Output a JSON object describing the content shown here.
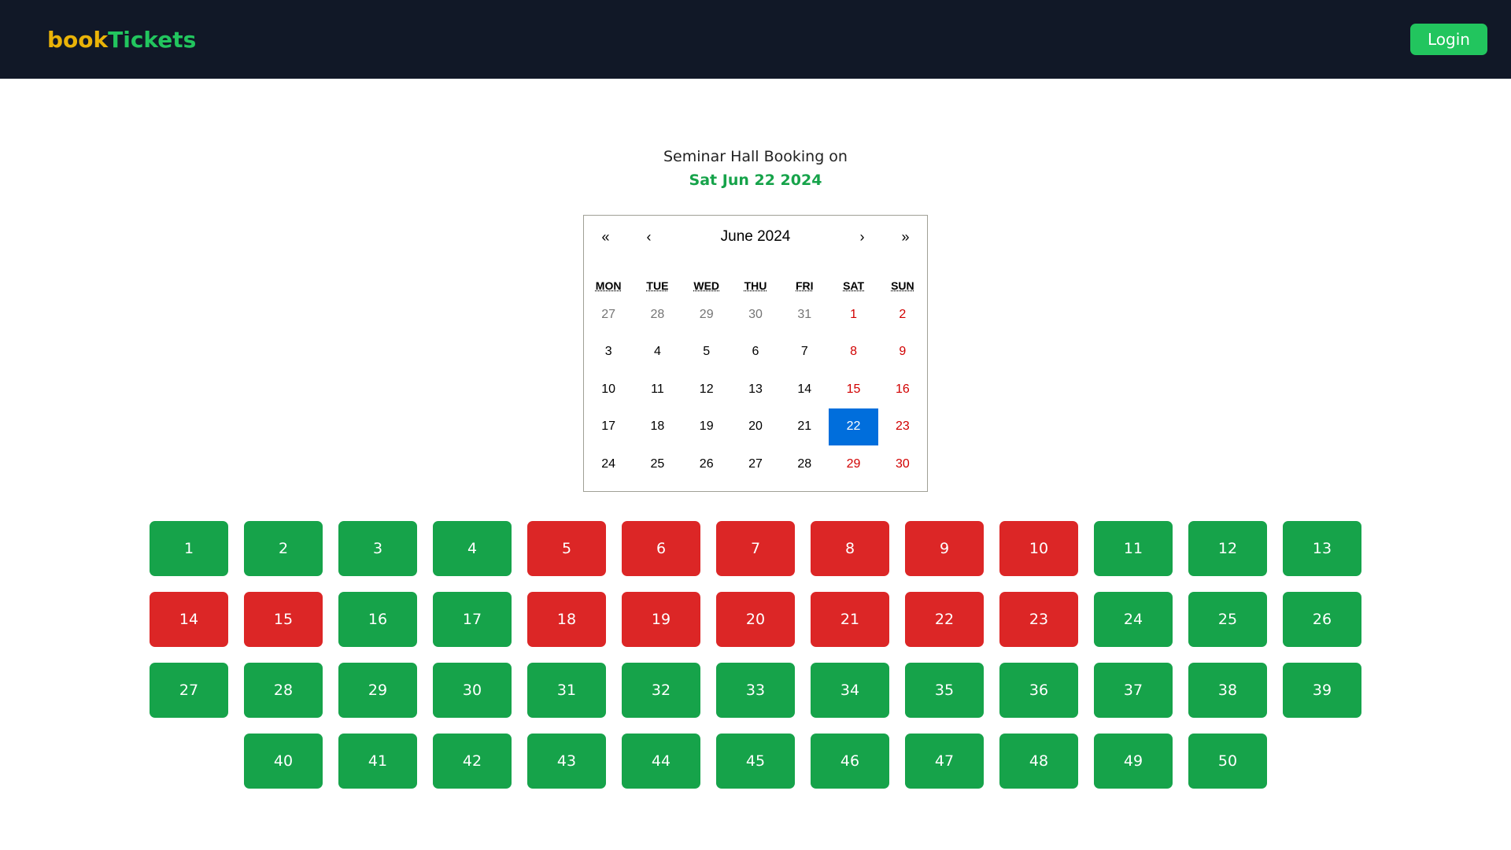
{
  "navbar": {
    "brand_part1": "book",
    "brand_part2": "Tickets",
    "login_label": "Login"
  },
  "heading": {
    "line1": "Seminar Hall Booking on",
    "date": "Sat Jun 22 2024"
  },
  "calendar": {
    "nav": {
      "prev2": "«",
      "prev": "‹",
      "label": "June 2024",
      "next": "›",
      "next2": "»"
    },
    "weekdays": [
      "MON",
      "TUE",
      "WED",
      "THU",
      "FRI",
      "SAT",
      "SUN"
    ],
    "days": [
      {
        "d": "27",
        "t": "neighbor"
      },
      {
        "d": "28",
        "t": "neighbor"
      },
      {
        "d": "29",
        "t": "neighbor"
      },
      {
        "d": "30",
        "t": "neighbor"
      },
      {
        "d": "31",
        "t": "neighbor"
      },
      {
        "d": "1",
        "t": "weekend"
      },
      {
        "d": "2",
        "t": "weekend"
      },
      {
        "d": "3",
        "t": ""
      },
      {
        "d": "4",
        "t": ""
      },
      {
        "d": "5",
        "t": ""
      },
      {
        "d": "6",
        "t": ""
      },
      {
        "d": "7",
        "t": ""
      },
      {
        "d": "8",
        "t": "weekend"
      },
      {
        "d": "9",
        "t": "weekend"
      },
      {
        "d": "10",
        "t": ""
      },
      {
        "d": "11",
        "t": ""
      },
      {
        "d": "12",
        "t": ""
      },
      {
        "d": "13",
        "t": ""
      },
      {
        "d": "14",
        "t": ""
      },
      {
        "d": "15",
        "t": "weekend"
      },
      {
        "d": "16",
        "t": "weekend"
      },
      {
        "d": "17",
        "t": ""
      },
      {
        "d": "18",
        "t": ""
      },
      {
        "d": "19",
        "t": ""
      },
      {
        "d": "20",
        "t": ""
      },
      {
        "d": "21",
        "t": ""
      },
      {
        "d": "22",
        "t": "selected"
      },
      {
        "d": "23",
        "t": "weekend"
      },
      {
        "d": "24",
        "t": ""
      },
      {
        "d": "25",
        "t": ""
      },
      {
        "d": "26",
        "t": ""
      },
      {
        "d": "27",
        "t": ""
      },
      {
        "d": "28",
        "t": ""
      },
      {
        "d": "29",
        "t": "weekend"
      },
      {
        "d": "30",
        "t": "weekend"
      }
    ]
  },
  "colors": {
    "available": "#16a34a",
    "booked": "#dc2626",
    "selected_day": "#006edc"
  },
  "seats": [
    [
      {
        "n": "1",
        "s": "available"
      },
      {
        "n": "2",
        "s": "available"
      },
      {
        "n": "3",
        "s": "available"
      },
      {
        "n": "4",
        "s": "available"
      },
      {
        "n": "5",
        "s": "booked"
      },
      {
        "n": "6",
        "s": "booked"
      },
      {
        "n": "7",
        "s": "booked"
      },
      {
        "n": "8",
        "s": "booked"
      },
      {
        "n": "9",
        "s": "booked"
      },
      {
        "n": "10",
        "s": "booked"
      },
      {
        "n": "11",
        "s": "available"
      },
      {
        "n": "12",
        "s": "available"
      },
      {
        "n": "13",
        "s": "available"
      }
    ],
    [
      {
        "n": "14",
        "s": "booked"
      },
      {
        "n": "15",
        "s": "booked"
      },
      {
        "n": "16",
        "s": "available"
      },
      {
        "n": "17",
        "s": "available"
      },
      {
        "n": "18",
        "s": "booked"
      },
      {
        "n": "19",
        "s": "booked"
      },
      {
        "n": "20",
        "s": "booked"
      },
      {
        "n": "21",
        "s": "booked"
      },
      {
        "n": "22",
        "s": "booked"
      },
      {
        "n": "23",
        "s": "booked"
      },
      {
        "n": "24",
        "s": "available"
      },
      {
        "n": "25",
        "s": "available"
      },
      {
        "n": "26",
        "s": "available"
      }
    ],
    [
      {
        "n": "27",
        "s": "available"
      },
      {
        "n": "28",
        "s": "available"
      },
      {
        "n": "29",
        "s": "available"
      },
      {
        "n": "30",
        "s": "available"
      },
      {
        "n": "31",
        "s": "available"
      },
      {
        "n": "32",
        "s": "available"
      },
      {
        "n": "33",
        "s": "available"
      },
      {
        "n": "34",
        "s": "available"
      },
      {
        "n": "35",
        "s": "available"
      },
      {
        "n": "36",
        "s": "available"
      },
      {
        "n": "37",
        "s": "available"
      },
      {
        "n": "38",
        "s": "available"
      },
      {
        "n": "39",
        "s": "available"
      }
    ],
    [
      {
        "n": "40",
        "s": "available"
      },
      {
        "n": "41",
        "s": "available"
      },
      {
        "n": "42",
        "s": "available"
      },
      {
        "n": "43",
        "s": "available"
      },
      {
        "n": "44",
        "s": "available"
      },
      {
        "n": "45",
        "s": "available"
      },
      {
        "n": "46",
        "s": "available"
      },
      {
        "n": "47",
        "s": "available"
      },
      {
        "n": "48",
        "s": "available"
      },
      {
        "n": "49",
        "s": "available"
      },
      {
        "n": "50",
        "s": "available"
      }
    ]
  ]
}
